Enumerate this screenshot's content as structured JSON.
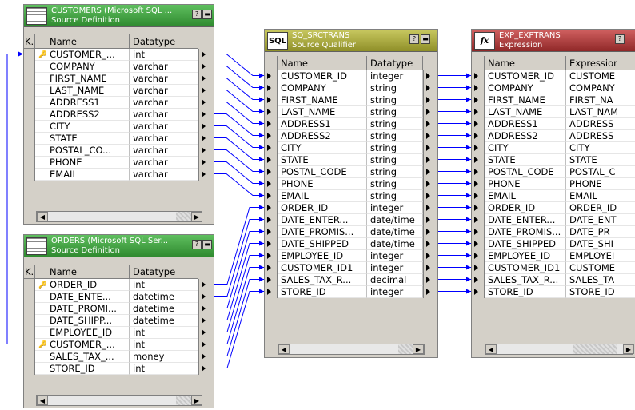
{
  "colors": {
    "source_header": "#3f9a3f",
    "qualifier_header": "#a0a030",
    "expression_header": "#b03a3a",
    "link": "#0000ff"
  },
  "customers": {
    "title": "CUSTOMERS (Microsoft SQL ...",
    "subtitle": "Source Definition",
    "col_key": "K.",
    "col_name": "Name",
    "col_type": "Datatype",
    "rows": [
      {
        "name": "CUSTOMER_...",
        "type": "int",
        "key": true
      },
      {
        "name": "COMPANY",
        "type": "varchar"
      },
      {
        "name": "FIRST_NAME",
        "type": "varchar"
      },
      {
        "name": "LAST_NAME",
        "type": "varchar"
      },
      {
        "name": "ADDRESS1",
        "type": "varchar"
      },
      {
        "name": "ADDRESS2",
        "type": "varchar"
      },
      {
        "name": "CITY",
        "type": "varchar"
      },
      {
        "name": "STATE",
        "type": "varchar"
      },
      {
        "name": "POSTAL_CO...",
        "type": "varchar"
      },
      {
        "name": "PHONE",
        "type": "varchar"
      },
      {
        "name": "EMAIL",
        "type": "varchar"
      }
    ]
  },
  "orders": {
    "title": "ORDERS (Microsoft SQL Ser...",
    "subtitle": "Source Definition",
    "col_key": "K.",
    "col_name": "Name",
    "col_type": "Datatype",
    "rows": [
      {
        "name": "ORDER_ID",
        "type": "int",
        "key": true
      },
      {
        "name": "DATE_ENTE...",
        "type": "datetime"
      },
      {
        "name": "DATE_PROMI...",
        "type": "datetime"
      },
      {
        "name": "DATE_SHIPP...",
        "type": "datetime"
      },
      {
        "name": "EMPLOYEE_ID",
        "type": "int"
      },
      {
        "name": "CUSTOMER_...",
        "type": "int",
        "key": true
      },
      {
        "name": "SALES_TAX_...",
        "type": "money"
      },
      {
        "name": "STORE_ID",
        "type": "int"
      }
    ]
  },
  "qualifier": {
    "badge": "SQL",
    "title": "SQ_SRCTRANS",
    "subtitle": "Source Qualifier",
    "col_name": "Name",
    "col_type": "Datatype",
    "rows": [
      {
        "name": "CUSTOMER_ID",
        "type": "integer"
      },
      {
        "name": "COMPANY",
        "type": "string"
      },
      {
        "name": "FIRST_NAME",
        "type": "string"
      },
      {
        "name": "LAST_NAME",
        "type": "string"
      },
      {
        "name": "ADDRESS1",
        "type": "string"
      },
      {
        "name": "ADDRESS2",
        "type": "string"
      },
      {
        "name": "CITY",
        "type": "string"
      },
      {
        "name": "STATE",
        "type": "string"
      },
      {
        "name": "POSTAL_CODE",
        "type": "string"
      },
      {
        "name": "PHONE",
        "type": "string"
      },
      {
        "name": "EMAIL",
        "type": "string"
      },
      {
        "name": "ORDER_ID",
        "type": "integer"
      },
      {
        "name": "DATE_ENTER...",
        "type": "date/time"
      },
      {
        "name": "DATE_PROMIS...",
        "type": "date/time"
      },
      {
        "name": "DATE_SHIPPED",
        "type": "date/time"
      },
      {
        "name": "EMPLOYEE_ID",
        "type": "integer"
      },
      {
        "name": "CUSTOMER_ID1",
        "type": "integer"
      },
      {
        "name": "SALES_TAX_R...",
        "type": "decimal"
      },
      {
        "name": "STORE_ID",
        "type": "integer"
      }
    ]
  },
  "expression": {
    "badge": "fx",
    "title": "EXP_EXPTRANS",
    "subtitle": "Expression",
    "col_name": "Name",
    "col_expr": "Expressior",
    "rows": [
      {
        "name": "CUSTOMER_ID",
        "expr": "CUSTOME"
      },
      {
        "name": "COMPANY",
        "expr": "COMPANY"
      },
      {
        "name": "FIRST_NAME",
        "expr": "FIRST_NA"
      },
      {
        "name": "LAST_NAME",
        "expr": "LAST_NAM"
      },
      {
        "name": "ADDRESS1",
        "expr": "ADDRESS"
      },
      {
        "name": "ADDRESS2",
        "expr": "ADDRESS"
      },
      {
        "name": "CITY",
        "expr": "CITY"
      },
      {
        "name": "STATE",
        "expr": "STATE"
      },
      {
        "name": "POSTAL_CODE",
        "expr": "POSTAL_C"
      },
      {
        "name": "PHONE",
        "expr": "PHONE"
      },
      {
        "name": "EMAIL",
        "expr": "EMAIL"
      },
      {
        "name": "ORDER_ID",
        "expr": "ORDER_ID"
      },
      {
        "name": "DATE_ENTER...",
        "expr": "DATE_ENT"
      },
      {
        "name": "DATE_PROMIS...",
        "expr": "DATE_PR"
      },
      {
        "name": "DATE_SHIPPED",
        "expr": "DATE_SHI"
      },
      {
        "name": "EMPLOYEE_ID",
        "expr": "EMPLOYEI"
      },
      {
        "name": "CUSTOMER_ID1",
        "expr": "CUSTOME"
      },
      {
        "name": "SALES_TAX_R...",
        "expr": "SALES_TA"
      },
      {
        "name": "STORE_ID",
        "expr": "STORE_ID"
      }
    ]
  }
}
